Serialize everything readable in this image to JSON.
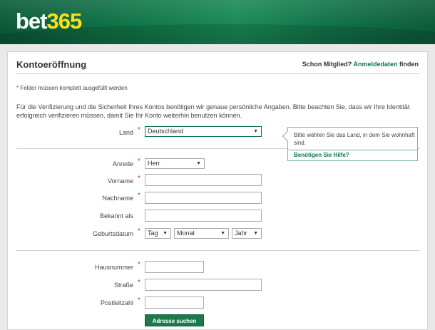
{
  "header": {
    "logo_bet": "bet",
    "logo_num": "365"
  },
  "page": {
    "title": "Kontoeröffnung",
    "member_prefix": "Schon Mitglied?",
    "member_link": "Anmeldedaten",
    "member_suffix": "finden",
    "required_note": "Felder müssen komplett ausgefüllt werden",
    "required_star": "*",
    "intro": "Für die Verifizierung und die Sicherheit Ihres Kontos benötigen wir genaue persönliche Angaben. Bitte beachten Sie, dass wir Ihre Identität erfolgreich verifizieren müssen, damit Sie Ihr Konto weiterhin benutzen können."
  },
  "form": {
    "land": {
      "label": "Land",
      "value": "Deutschland"
    },
    "anrede": {
      "label": "Anrede",
      "value": "Herr"
    },
    "vorname": {
      "label": "Vorname",
      "value": ""
    },
    "nachname": {
      "label": "Nachname",
      "value": ""
    },
    "bekannt": {
      "label": "Bekannt als",
      "value": ""
    },
    "geburtsdatum": {
      "label": "Geburtsdatum",
      "day": "Tag",
      "month": "Monat",
      "year": "Jahr"
    },
    "hausnummer": {
      "label": "Hausnummer",
      "value": ""
    },
    "strasse": {
      "label": "Straße",
      "value": ""
    },
    "plz": {
      "label": "Postleitzahl",
      "value": ""
    },
    "search_button": "Adresse suchen"
  },
  "tooltip": {
    "message": "Bitte wählen Sie das Land, in dem Sie wohnhaft sind.",
    "help": "Benötigen Sie Hilfe?"
  },
  "colors": {
    "brand_green": "#12744a",
    "logo_yellow": "#ffdf1b",
    "required_red": "#c0392b"
  },
  "icons": {
    "select_arrow": "triangle-down-icon"
  }
}
